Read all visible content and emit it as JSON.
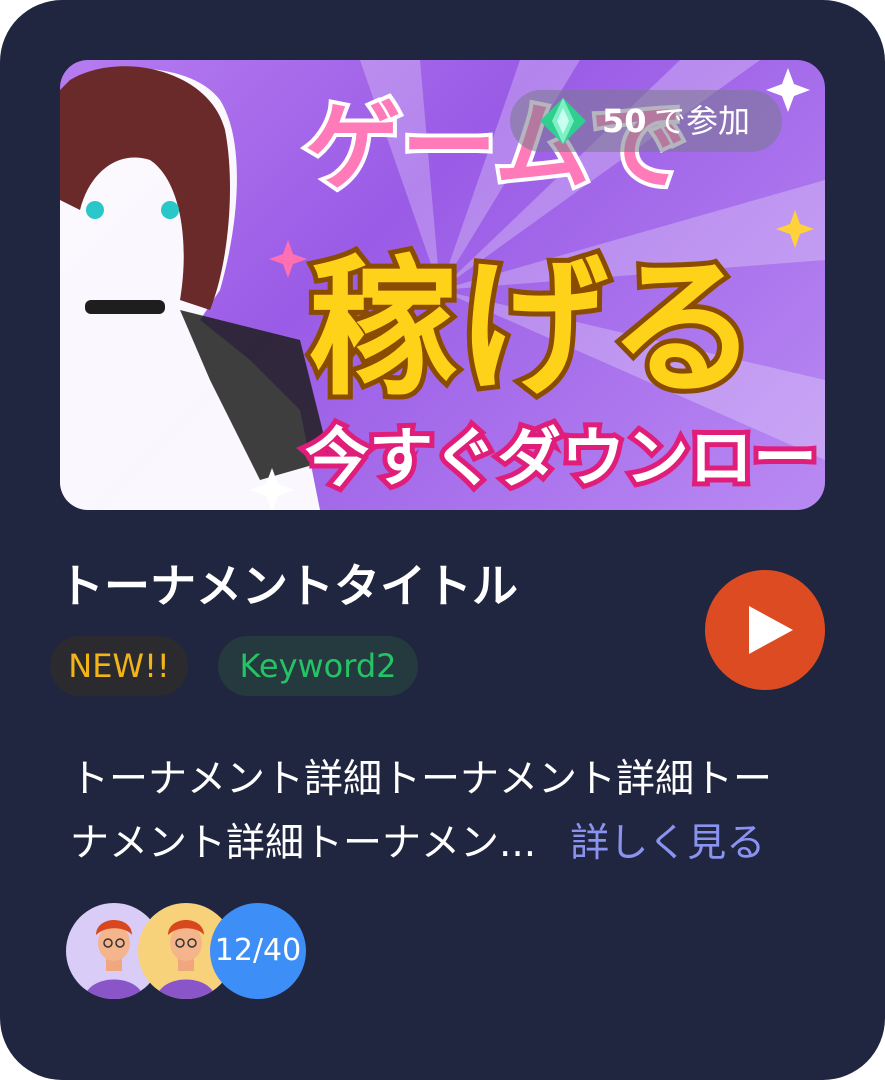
{
  "banner": {
    "entry_cost": "50",
    "entry_suffix": "で参加",
    "headline_line1": "ゲームで",
    "headline_line2": "稼げる",
    "headline_line3": "今すぐダウンロー"
  },
  "tournament": {
    "title": "トーナメントタイトル",
    "tags": [
      "NEW!!",
      "Keyword2"
    ],
    "description_line1": "トーナメント詳細トーナメント詳細トー",
    "description_line2": "ナメント詳細トーナメン...",
    "more_label": "詳しく見る",
    "participants": "12/40"
  },
  "colors": {
    "card_bg": "#212640",
    "play_button": "#dd4b22",
    "new_tag_text": "#f3b418",
    "keyword_tag_text": "#24c466",
    "link": "#8b93f0",
    "count_badge": "#3d8ef6"
  },
  "icons": [
    "gem-icon",
    "play-icon"
  ]
}
